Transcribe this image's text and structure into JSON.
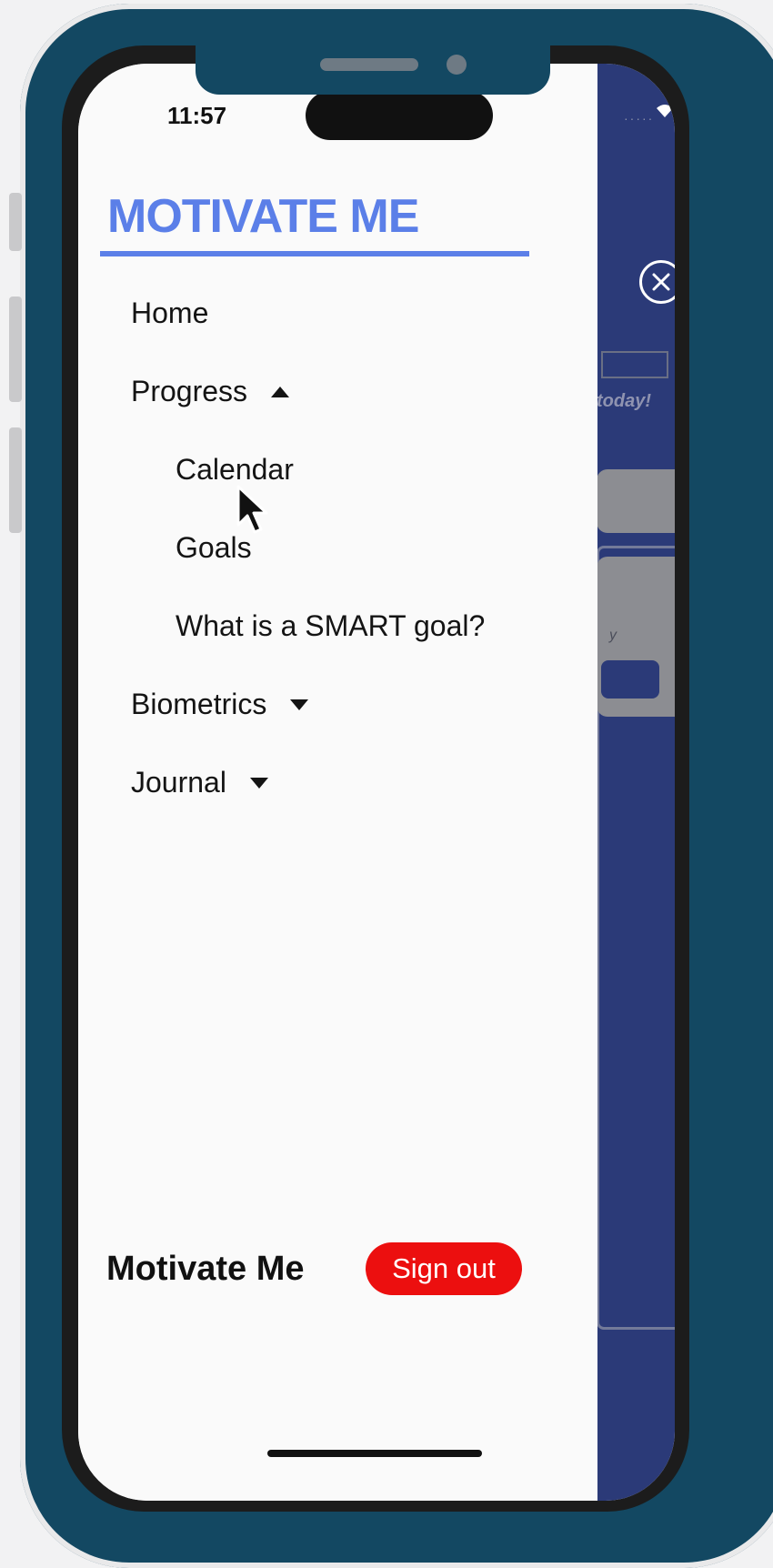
{
  "status_bar": {
    "time": "11:57"
  },
  "drawer": {
    "brand_title": "MOTIVATE ME",
    "nav": {
      "home": "Home",
      "progress": "Progress",
      "progress_children": {
        "calendar": "Calendar",
        "goals": "Goals",
        "smart": "What is a SMART goal?"
      },
      "biometrics": "Biometrics",
      "journal": "Journal"
    },
    "footer": {
      "brand": "Motivate Me",
      "sign_out_label": "Sign out"
    }
  },
  "background_app": {
    "today_text": "today!",
    "close_icon": "close-circle-icon",
    "card_text": "y"
  },
  "colors": {
    "frame": "#134862",
    "brand_blue": "#5b7fe8",
    "sign_out_red": "#ec0f0f",
    "background_app": "#2b3a78"
  }
}
